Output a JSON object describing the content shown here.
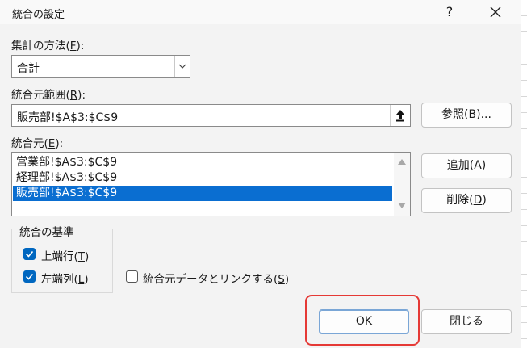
{
  "dialog": {
    "title": "統合の設定",
    "help": "?",
    "close_icon": "close-icon"
  },
  "function": {
    "label_pre": "集計の方法(",
    "label_key": "F",
    "label_post": "):",
    "value": "合計"
  },
  "reference": {
    "label_pre": "統合元範囲(",
    "label_key": "R",
    "label_post": "):",
    "value": "販売部!$A$3:$C$9",
    "browse_pre": "参照(",
    "browse_key": "B",
    "browse_post": ")..."
  },
  "all_references": {
    "label_pre": "統合元(",
    "label_key": "E",
    "label_post": "):",
    "items": [
      "営業部!$A$3:$C$9",
      "経理部!$A$3:$C$9",
      "販売部!$A$3:$C$9"
    ],
    "selected_index": 2,
    "add_pre": "追加(",
    "add_key": "A",
    "add_post": ")",
    "delete_pre": "削除(",
    "delete_key": "D",
    "delete_post": ")"
  },
  "labels": {
    "group_title": "統合の基準",
    "top_row_pre": "上端行(",
    "top_row_key": "T",
    "top_row_post": ")",
    "top_row_checked": true,
    "left_col_pre": "左端列(",
    "left_col_key": "L",
    "left_col_post": ")",
    "left_col_checked": true,
    "link_pre": "統合元データとリンクする(",
    "link_key": "S",
    "link_post": ")",
    "link_checked": false
  },
  "footer": {
    "ok": "OK",
    "close": "閉じる"
  },
  "colors": {
    "selection": "#0a6ed1",
    "checkbox": "#0067c0",
    "highlight": "#e53935"
  }
}
